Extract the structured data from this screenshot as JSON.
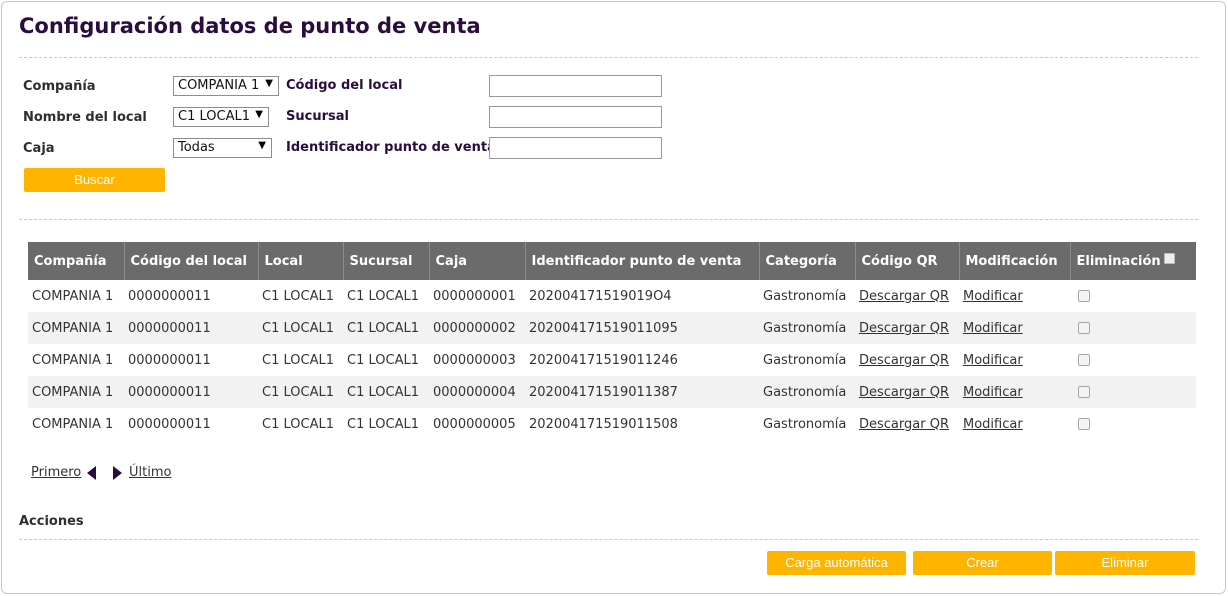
{
  "page": {
    "title": "Configuración datos de punto de venta"
  },
  "filters": {
    "company_label": "Compañía",
    "company_value": "COMPANIA 1",
    "local_name_label": "Nombre del local",
    "local_name_value": "C1 LOCAL1",
    "caja_label": "Caja",
    "caja_value": "Todas",
    "local_code_label": "Código del local",
    "local_code_value": "",
    "sucursal_label": "Sucursal",
    "sucursal_value": "",
    "pos_id_label": "Identificador punto de venta",
    "pos_id_value": "",
    "search_button": "Buscar"
  },
  "table": {
    "headers": {
      "company": "Compañía",
      "local_code": "Código del local",
      "local": "Local",
      "sucursal": "Sucursal",
      "caja": "Caja",
      "pos_id": "Identificador punto de venta",
      "category": "Categoría",
      "qr": "Código QR",
      "modify": "Modificación",
      "delete": "Eliminación"
    },
    "rows": [
      {
        "company": "COMPANIA 1",
        "local_code": "0000000011",
        "local": "C1 LOCAL1",
        "sucursal": "C1 LOCAL1",
        "caja": "0000000001",
        "pos_id": "202004171519019O4",
        "category": "Gastronomía",
        "qr": "Descargar QR",
        "modify": "Modificar"
      },
      {
        "company": "COMPANIA 1",
        "local_code": "0000000011",
        "local": "C1 LOCAL1",
        "sucursal": "C1 LOCAL1",
        "caja": "0000000002",
        "pos_id": "202004171519011095",
        "category": "Gastronomía",
        "qr": "Descargar QR",
        "modify": "Modificar"
      },
      {
        "company": "COMPANIA 1",
        "local_code": "0000000011",
        "local": "C1 LOCAL1",
        "sucursal": "C1 LOCAL1",
        "caja": "0000000003",
        "pos_id": "202004171519011246",
        "category": "Gastronomía",
        "qr": "Descargar QR",
        "modify": "Modificar"
      },
      {
        "company": "COMPANIA 1",
        "local_code": "0000000011",
        "local": "C1 LOCAL1",
        "sucursal": "C1 LOCAL1",
        "caja": "0000000004",
        "pos_id": "202004171519011387",
        "category": "Gastronomía",
        "qr": "Descargar QR",
        "modify": "Modificar"
      },
      {
        "company": "COMPANIA 1",
        "local_code": "0000000011",
        "local": "C1 LOCAL1",
        "sucursal": "C1 LOCAL1",
        "caja": "0000000005",
        "pos_id": "202004171519011508",
        "category": "Gastronomía",
        "qr": "Descargar QR",
        "modify": "Modificar"
      }
    ]
  },
  "pager": {
    "first": "Primero",
    "last": "Último"
  },
  "actions": {
    "title": "Acciones",
    "auto_load": "Carga automática",
    "create": "Crear",
    "delete": "Eliminar"
  },
  "colors": {
    "title": "#2b0c3f",
    "accent": "#ffb400",
    "header_bg": "#6b6b6b"
  }
}
